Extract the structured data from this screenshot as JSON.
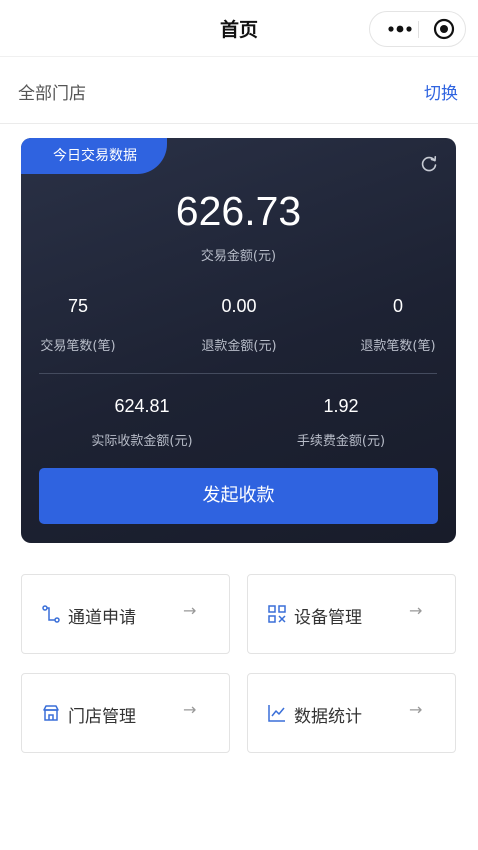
{
  "navbar": {
    "title": "首页"
  },
  "store": {
    "name": "全部门店",
    "switch_label": "切换"
  },
  "card": {
    "tag": "今日交易数据",
    "amount": "626.73",
    "amount_label": "交易金额(元)",
    "stats": [
      {
        "value": "75",
        "label": "交易笔数(笔)"
      },
      {
        "value": "0.00",
        "label": "退款金额(元)"
      },
      {
        "value": "0",
        "label": "退款笔数(笔)"
      },
      {
        "value": "624.81",
        "label": "实际收款金额(元)"
      },
      {
        "value": "1.92",
        "label": "手续费金额(元)"
      }
    ],
    "button_label": "发起收款"
  },
  "menu": [
    {
      "label": "通道申请",
      "icon": "route-icon",
      "arrow": "→"
    },
    {
      "label": "设备管理",
      "icon": "device-icon",
      "arrow": "→"
    },
    {
      "label": "门店管理",
      "icon": "store-icon",
      "arrow": "→"
    },
    {
      "label": "数据统计",
      "icon": "chart-line-icon",
      "arrow": "→"
    }
  ],
  "colors": {
    "accent": "#2f63e0",
    "card_bg": "#1d2233",
    "icon": "#3a6fd8"
  }
}
